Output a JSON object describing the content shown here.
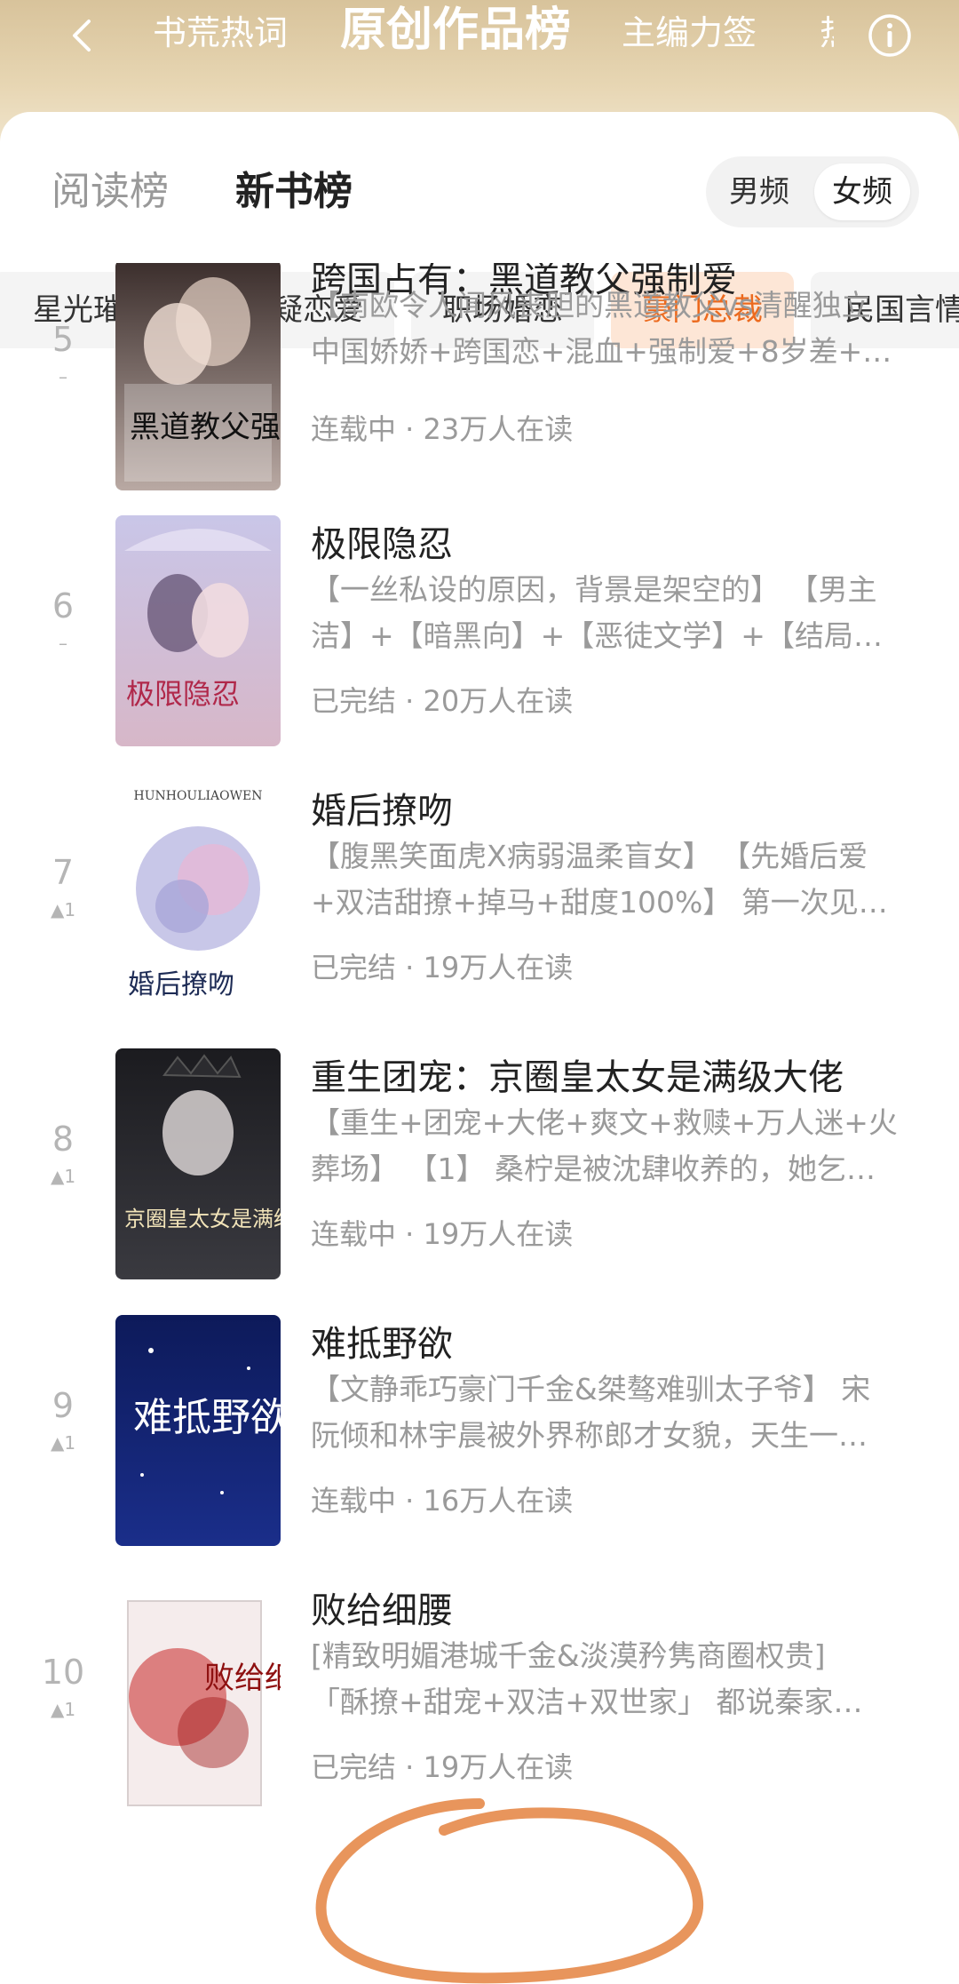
{
  "header": {
    "tabs": [
      {
        "label": "书荒热词"
      },
      {
        "label": "原创作品榜"
      },
      {
        "label": "主编力签"
      },
      {
        "label": "热"
      }
    ]
  },
  "rank_tabs": [
    {
      "label": "阅读榜"
    },
    {
      "label": "新书榜"
    }
  ],
  "gender": [
    {
      "label": "男频"
    },
    {
      "label": "女频"
    }
  ],
  "categories": [
    {
      "label": "星光璀璨"
    },
    {
      "label": "悬疑恋爱"
    },
    {
      "label": "职场婚恋"
    },
    {
      "label": "豪门总裁"
    },
    {
      "label": "民国言情"
    }
  ],
  "books": [
    {
      "rank": "5",
      "change": "–",
      "title": "跨国占有：黑道教父强制爱",
      "desc1": "【南欧令人闻风丧胆的黑道教父vs清醒独立",
      "desc2": "中国娇娇+跨国恋+混血+强制爱+8岁差+性…",
      "meta": "连载中 · 23万人在读",
      "cover_text": "黑道教父强制爱"
    },
    {
      "rank": "6",
      "change": "–",
      "title": "极限隐忍",
      "desc1": "【一丝私设的原因，背景是架空的】 【男主",
      "desc2": "洁】+【暗黑向】+【恶徒文学】+【结局…",
      "meta": "已完结 · 20万人在读",
      "cover_text": "极限隐忍"
    },
    {
      "rank": "7",
      "change": "▲1",
      "title": "婚后撩吻",
      "desc1": "【腹黑笑面虎X病弱温柔盲女】 【先婚后爱",
      "desc2": "+双洁甜撩+掉马+甜度100%】 第一次见…",
      "meta": "已完结 · 19万人在读",
      "cover_text": "婚后撩吻",
      "cover_top": "HUNHOULIAOWEN"
    },
    {
      "rank": "8",
      "change": "▲1",
      "title": "重生团宠：京圈皇太女是满级大佬",
      "desc1": "【重生+团宠+大佬+爽文+救赎+万人迷+火",
      "desc2": "葬场】 【1】 桑柠是被沈肆收养的，她乞…",
      "meta": "连载中 · 19万人在读",
      "cover_text": "京圈皇太女是满级大佬"
    },
    {
      "rank": "9",
      "change": "▲1",
      "title": "难抵野欲",
      "desc1": "【文静乖巧豪门千金&桀骜难驯太子爷】 宋",
      "desc2": "阮倾和林宇晨被外界称郎才女貌，天生一…",
      "meta": "连载中 · 16万人在读",
      "cover_text": "难抵野欲"
    },
    {
      "rank": "10",
      "change": "▲1",
      "title": "败给细腰",
      "desc1": "[精致明媚港城千金&淡漠矜隽商圈权贵]",
      "desc2": "「酥撩+甜宠+双洁+双世家」 都说秦家…",
      "meta": "已完结 · 19万人在读",
      "cover_text": "败给细腰"
    }
  ],
  "colors": {
    "accent": "#ec6a1e",
    "annotation": "#e8955c"
  }
}
